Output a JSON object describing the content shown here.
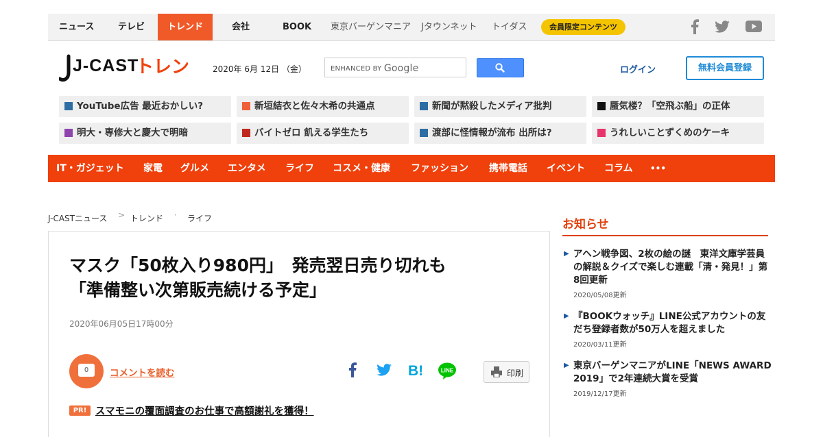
{
  "topnav": {
    "items": [
      "ニュース",
      "テレビ",
      "トレンド",
      "会社",
      "BOOK",
      "東京バーゲンマニア",
      "Jタウンネット",
      "トイダス"
    ],
    "member": "会員限定コンテンツ"
  },
  "header": {
    "logo_main": "J-CAST",
    "logo_sub": "トレンド",
    "date": "2020年 6月 12日 （金）",
    "search_prefix": "ENHANCED BY",
    "search_brand": "Google",
    "login": "ログイン",
    "register": "無料会員登録"
  },
  "trends": [
    {
      "label": "YouTube広告 最近おかしい?",
      "color": "#2e6da4"
    },
    {
      "label": "新垣結衣と佐々木希の共通点",
      "color": "#f0603a"
    },
    {
      "label": "新聞が黙殺したメディア批判",
      "color": "#2e6da4"
    },
    {
      "label": "蜃気楼？「空飛ぶ船」の正体",
      "color": "#111111"
    },
    {
      "label": "明大・専修大と慶大で明暗",
      "color": "#8e44ad"
    },
    {
      "label": "バイトゼロ 飢える学生たち",
      "color": "#c0281e"
    },
    {
      "label": "渡部に怪情報が流布 出所は?",
      "color": "#2e6da4"
    },
    {
      "label": "うれしいことずくめのケーキ",
      "color": "#e8336b"
    }
  ],
  "categories": [
    "IT・ガジェット",
    "家電",
    "グルメ",
    "エンタメ",
    "ライフ",
    "コスメ・健康",
    "ファッション",
    "携帯電話",
    "イベント",
    "コラム",
    "•••"
  ],
  "breadcrumb": [
    "J-CASTニュース",
    "トレンド",
    "ライフ"
  ],
  "article": {
    "title_line1": "マスク「50枚入り980円」　発売翌日売り切れも",
    "title_line2": "「準備整い次第販売続ける予定」",
    "date": "2020年06月05日17時00分",
    "comment_count": "0",
    "comment_link": "コメントを読む",
    "print": "印刷",
    "pr_badge": "PR!",
    "pr_link": "スマモニの覆面調査のお仕事で高額謝礼を獲得！"
  },
  "sidebar": {
    "heading": "お知らせ",
    "news": [
      {
        "title": "アヘン戦争図、2枚の絵の謎　東洋文庫学芸員の解説＆クイズで楽しむ連載「清・発見！」第8回更新",
        "date": "2020/05/08更新"
      },
      {
        "title": "『BOOKウォッチ』LINE公式アカウントの友だち登録者数が50万人を超えました",
        "date": "2020/03/11更新"
      },
      {
        "title": "東京バーゲンマニアがLINE「NEWS AWARD 2019」で2年連続大賞を受賞",
        "date": "2019/12/17更新"
      }
    ]
  },
  "colors": {
    "accent": "#f0400c",
    "link": "#1f5aa0",
    "member": "#f5c400"
  }
}
